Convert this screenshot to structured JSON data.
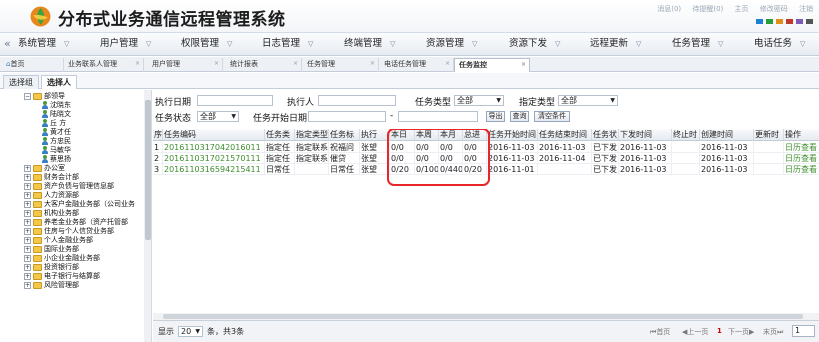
{
  "header": {
    "title": "分布式业务通信远程管理系统",
    "top_links": [
      "消息(0)",
      "待提醒(0)",
      "主页",
      "修改密码",
      "注销"
    ],
    "skin_colors": [
      "#1d7fd6",
      "#2a9a3c",
      "#e28c1a",
      "#c0392b",
      "#7d5bb8",
      "#555555"
    ]
  },
  "nav": {
    "collapse_symbol": "«",
    "items": [
      "系统管理",
      "用户管理",
      "权限管理",
      "日志管理",
      "终端管理",
      "资源管理",
      "资源下发",
      "远程更新",
      "任务管理",
      "电话任务"
    ],
    "dropdown_symbol": "▽"
  },
  "tabs": {
    "items": [
      {
        "label": "首页",
        "closable": false
      },
      {
        "label": "业务联系人管理",
        "closable": true
      },
      {
        "label": "用户管理",
        "closable": true
      },
      {
        "label": "统计报表",
        "closable": true
      },
      {
        "label": "任务管理",
        "closable": true
      },
      {
        "label": "电话任务管理",
        "closable": true
      },
      {
        "label": "任务监控",
        "closable": true,
        "active": true
      }
    ],
    "close_symbol": "×"
  },
  "subtabs": {
    "items": [
      "选择组",
      "选择人"
    ],
    "active": "选择人"
  },
  "tree": {
    "nodes": [
      {
        "type": "folder",
        "expanded": true,
        "label": "部领导",
        "level": 1
      },
      {
        "type": "person",
        "label": "沈晓东",
        "level": 2
      },
      {
        "type": "person",
        "label": "陆晓文",
        "level": 2
      },
      {
        "type": "person",
        "label": "丘 方",
        "level": 2
      },
      {
        "type": "person",
        "label": "黄才任",
        "level": 2
      },
      {
        "type": "person",
        "label": "方忠民",
        "level": 2
      },
      {
        "type": "person",
        "label": "马敏华",
        "level": 2
      },
      {
        "type": "person",
        "label": "蔡思扬",
        "level": 2
      },
      {
        "type": "folder",
        "label": "办公室",
        "level": 1
      },
      {
        "type": "folder",
        "label": "财务会计部",
        "level": 1
      },
      {
        "type": "folder",
        "label": "资产负债与管理信息部",
        "level": 1
      },
      {
        "type": "folder",
        "label": "人力资源部",
        "level": 1
      },
      {
        "type": "folder",
        "label": "大客户金融业务部（公司业务",
        "level": 1
      },
      {
        "type": "folder",
        "label": "机构业务部",
        "level": 1
      },
      {
        "type": "folder",
        "label": "养老金业务部（资产托管部",
        "level": 1
      },
      {
        "type": "folder",
        "label": "住房与个人信贷业务部",
        "level": 1
      },
      {
        "type": "folder",
        "label": "个人金融业务部",
        "level": 1
      },
      {
        "type": "folder",
        "label": "国际业务部",
        "level": 1
      },
      {
        "type": "folder",
        "label": "小企业金融业务部",
        "level": 1
      },
      {
        "type": "folder",
        "label": "投资银行部",
        "level": 1
      },
      {
        "type": "folder",
        "label": "电子银行与结算部",
        "level": 1
      },
      {
        "type": "folder",
        "label": "风险管理部",
        "level": 1
      }
    ]
  },
  "filters": {
    "exec_date_label": "执行日期",
    "executor_label": "执行人",
    "task_type_label": "任务类型",
    "task_type_value": "全部",
    "assign_type_label": "指定类型",
    "assign_type_value": "全部",
    "task_status_label": "任务状态",
    "task_status_value": "全部",
    "start_date_label": "任务开始日期",
    "range_sep": "-",
    "export_label": "导出",
    "query_label": "查询",
    "clear_label": "清空条件"
  },
  "table": {
    "columns": [
      "序号",
      "任务编码",
      "任务类",
      "指定类型",
      "任务标",
      "执行",
      "本日",
      "本周",
      "本月",
      "总进",
      "任务开始时间",
      "任务结束时间",
      "任务状",
      "下发时间",
      "终止时",
      "创建时间",
      "更新时",
      "操作"
    ],
    "rows": [
      [
        "1",
        "2016110317042016011",
        "指定任",
        "指定联系",
        "祝福问",
        "张望",
        "0/0",
        "0/0",
        "0/0",
        "0/0",
        "2016-11-03",
        "2016-11-03",
        "已下发",
        "2016-11-03",
        "",
        "2016-11-03",
        "",
        "日历查看"
      ],
      [
        "2",
        "2016110317021570111",
        "指定任",
        "指定联系",
        "催贷",
        "张望",
        "0/0",
        "0/0",
        "0/0",
        "0/0",
        "2016-11-03",
        "2016-11-04",
        "已下发",
        "2016-11-03",
        "",
        "2016-11-03",
        "",
        "日历查看"
      ],
      [
        "3",
        "2016110316594215411",
        "日常任",
        "",
        "日常任",
        "张望",
        "0/20",
        "0/100",
        "0/440",
        "0/20",
        "2016-11-01",
        "",
        "已下发",
        "2016-11-03",
        "",
        "2016-11-03",
        "",
        "日历查看"
      ]
    ]
  },
  "footer": {
    "show_label": "显示",
    "page_size": "20",
    "unit_label": "条，共3条",
    "first": "首页",
    "prev": "上一页",
    "current": "1",
    "next": "下一页",
    "last": "末页",
    "page_input": "1"
  }
}
